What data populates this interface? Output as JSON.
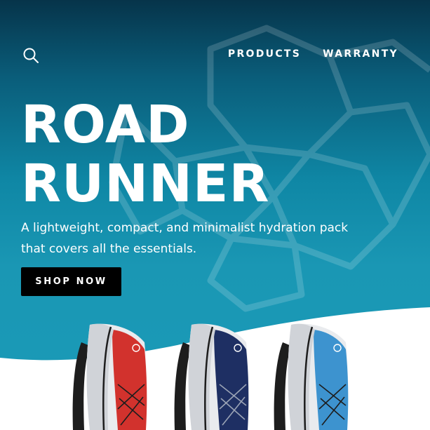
{
  "header": {
    "search_icon": "search-icon",
    "nav": [
      {
        "label": "PRODUCTS"
      },
      {
        "label": "WARRANTY"
      }
    ]
  },
  "hero": {
    "title_line1": "ROAD",
    "title_line2": "RUNNER",
    "subtitle": "A lightweight, compact, and minimalist hydration pack that covers all the essentials.",
    "cta_label": "SHOP NOW"
  },
  "products": [
    {
      "name_icon": "backpack-red-icon",
      "color": "#d2322d"
    },
    {
      "name_icon": "backpack-navy-icon",
      "color": "#1e2f63"
    },
    {
      "name_icon": "backpack-blue-icon",
      "color": "#3d93cf"
    }
  ],
  "colors": {
    "hero_top": "#06344a",
    "hero_bottom": "#1b9bb8",
    "button_bg": "#000000",
    "text": "#ffffff"
  }
}
